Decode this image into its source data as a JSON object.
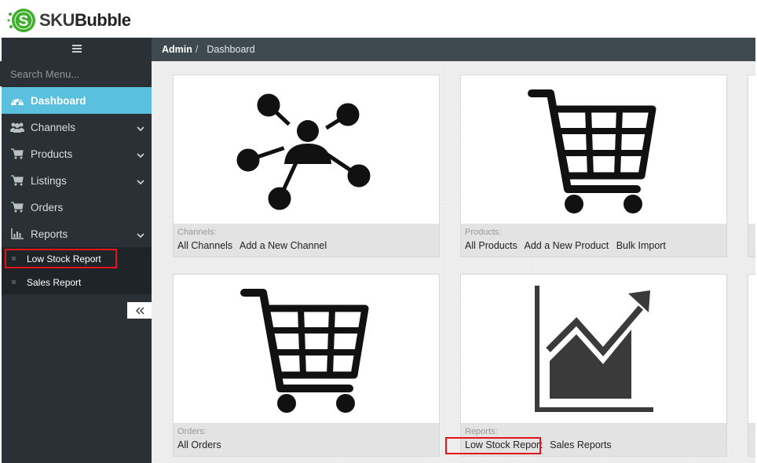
{
  "brand": {
    "name": "SKUBubble",
    "accent": "#5bc0de",
    "logo_green": "#3fae2a"
  },
  "search": {
    "placeholder": "Search Menu..."
  },
  "sidebar": {
    "items": [
      {
        "label": "Dashboard",
        "icon": "dashboard-icon",
        "active": true
      },
      {
        "label": "Channels",
        "icon": "users-icon"
      },
      {
        "label": "Products",
        "icon": "cart-icon"
      },
      {
        "label": "Listings",
        "icon": "cart-icon"
      },
      {
        "label": "Orders",
        "icon": "cart-icon"
      },
      {
        "label": "Reports",
        "icon": "bar-chart-icon"
      }
    ],
    "reports_sub": [
      {
        "label": "Low Stock Report",
        "highlighted": true
      },
      {
        "label": "Sales Report"
      }
    ],
    "collapse_icon": "double-chevron-left-icon"
  },
  "breadcrumb": {
    "root": "Admin",
    "separator": "/",
    "current": "Dashboard"
  },
  "cards": {
    "channels": {
      "title": "Channels:",
      "links": [
        "All Channels",
        "Add a New Channel"
      ]
    },
    "products": {
      "title": "Products:",
      "links": [
        "All Products",
        "Add a New Product",
        "Bulk Import"
      ]
    },
    "orders": {
      "title": "Orders:",
      "links": [
        "All Orders"
      ]
    },
    "reports": {
      "title": "Reports:",
      "links": [
        "Low Stock Report",
        "Sales Reports"
      ]
    }
  },
  "colors": {
    "sidebar_bg": "#2a3035",
    "topbar_bg": "#3e4a50",
    "highlight": "#e3151a"
  }
}
